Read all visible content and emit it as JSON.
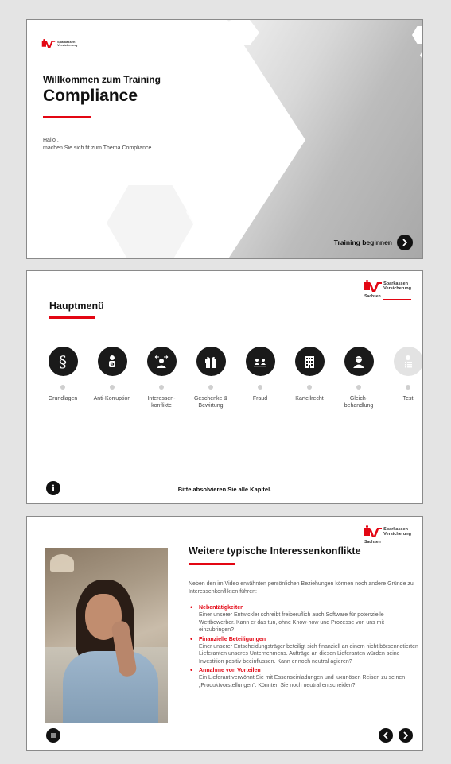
{
  "brand": {
    "name_line1": "Sparkassen",
    "name_line2": "Versicherung",
    "region": "Sachsen",
    "accent_color": "#e30613"
  },
  "slide1": {
    "welcome": "Willkommen zum Training",
    "title": "Compliance",
    "greeting_line1": "Hallo ,",
    "greeting_line2": "machen Sie sich fit zum Thema Compliance.",
    "start_label": "Training beginnen",
    "start_icon": "chevron-right-icon"
  },
  "slide2": {
    "title": "Hauptmenü",
    "items": [
      {
        "icon": "paragraph-icon",
        "label": "Grundlagen",
        "enabled": true
      },
      {
        "icon": "anti-bribery-icon",
        "label": "Anti-Korruption",
        "enabled": true
      },
      {
        "icon": "conflict-icon",
        "label": "Interessen-\nkonflikte",
        "enabled": true
      },
      {
        "icon": "gift-icon",
        "label": "Geschenke &\nBewirtung",
        "enabled": true
      },
      {
        "icon": "fraud-icon",
        "label": "Fraud",
        "enabled": true
      },
      {
        "icon": "building-icon",
        "label": "Kartellrecht",
        "enabled": true
      },
      {
        "icon": "person-icon",
        "label": "Gleich-\nbehandlung",
        "enabled": true
      },
      {
        "icon": "test-icon",
        "label": "Test",
        "enabled": false
      }
    ],
    "info_label": "i",
    "hint": "Bitte absolvieren Sie alle Kapitel."
  },
  "slide3": {
    "title": "Weitere typische Interessenkonflikte",
    "intro": "Neben den im Video erwähnten persönlichen Beziehungen können noch andere Gründe zu Interessenkonflikten führen:",
    "points": [
      {
        "heading": "Nebentätigkeiten",
        "text": "Einer unserer Entwickler schreibt freiberuflich auch Software für potenzielle Wettbewerber. Kann er das tun, ohne Know-how und Prozesse von uns mit einzubringen?"
      },
      {
        "heading": "Finanzielle Beteiligungen",
        "text": "Einer unserer Entscheidungsträger beteiligt sich finanziell an einem nicht börsennotierten Lieferanten unseres Unternehmens. Aufträge an diesen Lieferanten würden seine Investition positiv beeinflussen. Kann er noch neutral agieren?"
      },
      {
        "heading": "Annahme von Vorteilen",
        "text": "Ein Lieferant verwöhnt Sie mit Essenseinladungen und luxuriösen Reisen zu seinen „Produktvorstellungen“. Könnten Sie noch neutral entscheiden?"
      }
    ]
  }
}
